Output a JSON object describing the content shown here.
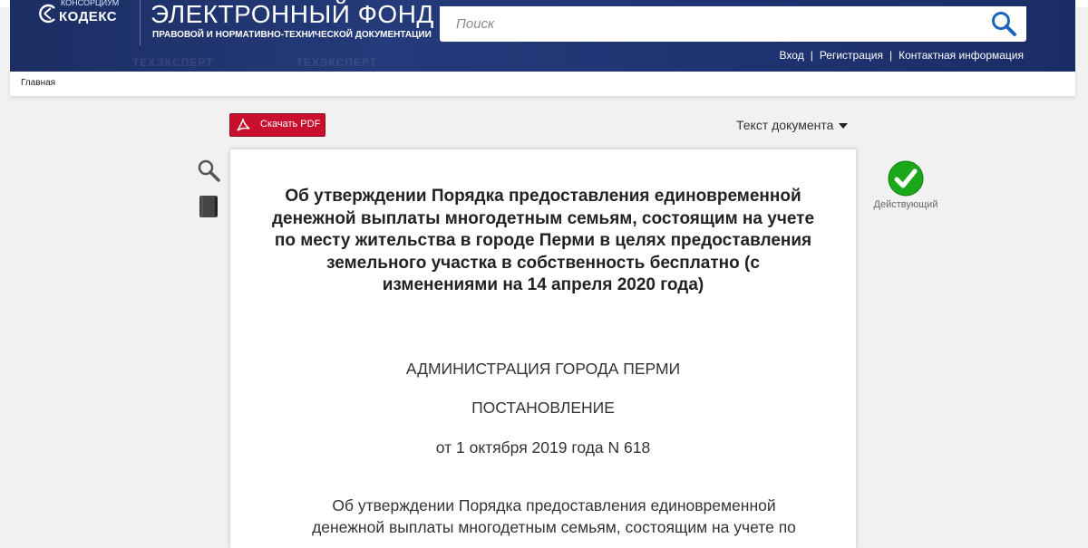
{
  "header": {
    "logo_small_text": "КОНСОРЦИУМ",
    "logo_name": "КОДЕКС",
    "title": "ЭЛЕКТРОННЫЙ ФОНД",
    "subtitle": "ПРАВОВОЙ И НОРМАТИВНО-ТЕХНИЧЕСКОЙ ДОКУМЕНТАЦИИ",
    "search_placeholder": "Поиск",
    "links": {
      "login": "Вход",
      "register": "Регистрация",
      "contacts": "Контактная информация"
    }
  },
  "breadcrumb": {
    "home": "Главная"
  },
  "toolbar": {
    "pdf_label": "Скачать PDF",
    "view_label": "Текст документа"
  },
  "status": {
    "label": "Действующий",
    "color": "#1aa81a"
  },
  "document": {
    "title": "Об утверждении Порядка предоставления единовременной денежной выплаты многодетным семьям, состоящим на учете по месту жительства в городе Перми в целях предоставления земельного участка в собственность бесплатно (с изменениями на 14 апреля 2020 года)",
    "authority": "АДМИНИСТРАЦИЯ ГОРОДА ПЕРМИ",
    "doc_type": "ПОСТАНОВЛЕНИЕ",
    "date_number": "от 1 октября 2019 года N 618",
    "body_start": "Об утверждении Порядка предоставления единовременной денежной выплаты многодетным семьям, состоящим на учете по"
  },
  "colors": {
    "header_bg": "#1f3372",
    "pdf_red": "#c8102e",
    "status_green": "#1aa81a"
  }
}
